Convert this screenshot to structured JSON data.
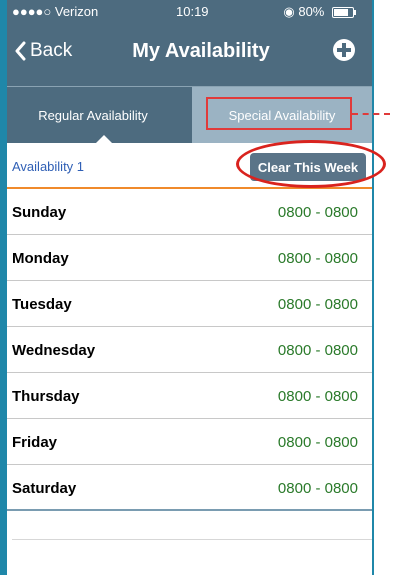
{
  "status_bar": {
    "carrier": "●●●●○ Verizon",
    "time": "10:19",
    "battery_text": "80%",
    "battery_level": 0.8
  },
  "nav": {
    "back_label": "Back",
    "title": "My Availability",
    "add_icon": "plus-circle-icon"
  },
  "tabs": {
    "regular": "Regular Availability",
    "special": "Special Availability",
    "selected": "regular"
  },
  "availability": {
    "label": "Availability 1",
    "clear_button": "Clear This Week"
  },
  "days": [
    {
      "name": "Sunday",
      "time": "0800 - 0800"
    },
    {
      "name": "Monday",
      "time": "0800 - 0800"
    },
    {
      "name": "Tuesday",
      "time": "0800 - 0800"
    },
    {
      "name": "Wednesday",
      "time": "0800 - 0800"
    },
    {
      "name": "Thursday",
      "time": "0800 - 0800"
    },
    {
      "name": "Friday",
      "time": "0800 - 0800"
    },
    {
      "name": "Saturday",
      "time": "0800 - 0800"
    }
  ],
  "colors": {
    "nav_bg": "#4d6b7f",
    "tab_inactive": "#9bb3c3",
    "accent_orange": "#f08a2b",
    "time_green": "#2a7a2a",
    "annotation_red": "#e03a3a",
    "frame_blue": "#1f87a9"
  }
}
